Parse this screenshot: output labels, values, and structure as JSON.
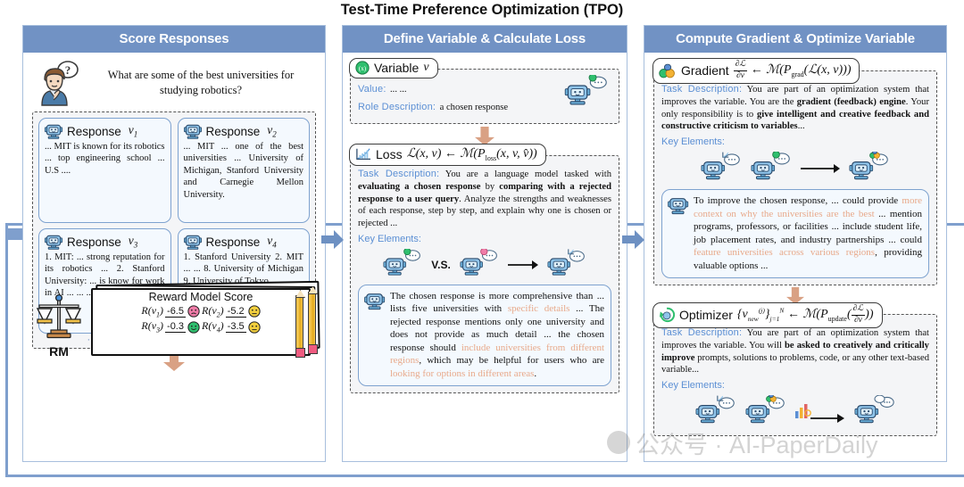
{
  "title": "Test-Time Preference Optimization (TPO)",
  "panels": {
    "score": {
      "header": "Score Responses",
      "query": "What are some of the best universities for studying robotics?",
      "query_icon": "person-question-icon",
      "responses": [
        {
          "label": "Response",
          "var": "v",
          "sub": "1",
          "text": "... MIT is known for its robotics ... top engineering school ... U.S ...."
        },
        {
          "label": "Response",
          "var": "v",
          "sub": "2",
          "text": "... MIT ... one of the best universities ... University of Michigan, Stanford University and Carnegie Mellon University."
        },
        {
          "label": "Response",
          "var": "v",
          "sub": "3",
          "text": "1. MIT: ... strong reputation for its robotics ... 2. Stanford University: ... is know for work in AI ... ... ... 5. CMU: ... oldest ..."
        },
        {
          "label": "Response",
          "var": "v",
          "sub": "4",
          "text": "1. Stanford University 2. MIT ... ... 8. University of Michigan 9. University of Tokyo"
        }
      ],
      "dots": [
        "· · ·",
        "· · ·",
        "· · ·",
        "· · ·"
      ],
      "rm": {
        "icon": "balance-scale-icon",
        "label": "RM",
        "card_title": "Reward Model Score",
        "scores": [
          {
            "key": "R",
            "var": "v",
            "sub": "1",
            "value": "-6.5",
            "face": "sad",
            "face_color": "#f07ca8"
          },
          {
            "key": "R",
            "var": "v",
            "sub": "2",
            "value": "-5.2",
            "face": "neutral",
            "face_color": "#f2cf3e"
          },
          {
            "key": "R",
            "var": "v",
            "sub": "3",
            "value": "-0.3",
            "face": "happy",
            "face_color": "#2fbf6e"
          },
          {
            "key": "R",
            "var": "v",
            "sub": "4",
            "value": "-3.5",
            "face": "neutral",
            "face_color": "#f2cf3e"
          }
        ]
      }
    },
    "define": {
      "header": "Define Variable & Calculate Loss",
      "variable": {
        "chip_icon": "variable-green-icon",
        "chip_label": "Variable",
        "chip_var": "v",
        "value_label": "Value:",
        "value_text": "... ...",
        "role_label": "Role Description:",
        "role_text": "a chosen response",
        "robot_icon": "robot-chat-icon"
      },
      "loss": {
        "chip_icon": "loss-chart-icon",
        "chip_label": "Loss",
        "chip_formula": "L(x, v) ← M(P_loss(x, v, v̂))",
        "task_label": "Task Description:",
        "task_text_1": "You are a language model tasked with ",
        "task_bold_1": "evaluating a chosen response",
        "task_text_2": " by ",
        "task_bold_2": "comparing with a rejected response to a user query",
        "task_text_3": ". Analyze the strengths and weaknesses of each response, step by step, and explain why one is chosen or rejected ...",
        "key_elements_label": "Key Elements:",
        "vs_label": "V.S.",
        "robots": [
          "robot-chosen-icon",
          "robot-rejected-icon",
          "robot-loss-icon"
        ],
        "output_icon": "robot-icon",
        "output_parts": [
          {
            "t": "The chosen response is more comprehensive than ... lists five universities with ",
            "hl": false
          },
          {
            "t": "specific details",
            "hl": true
          },
          {
            "t": " ... The rejected response mentions only one university and does not provide as much detail ... the chosen response should ",
            "hl": false
          },
          {
            "t": "include universities from different regions",
            "hl": true
          },
          {
            "t": ", which may be helpful for users who are ",
            "hl": false
          },
          {
            "t": "looking for options in different areas",
            "hl": true
          },
          {
            "t": ".",
            "hl": false
          }
        ]
      }
    },
    "gradient": {
      "header": "Compute Gradient & Optimize Variable",
      "grad": {
        "chip_icon": "gradient-icon",
        "chip_label": "Gradient",
        "chip_formula": "∂L/∂v ← M(P_grad(L(x, v)))",
        "task_label": "Task Description:",
        "task_text_1": "You are part of an optimization system that improves the variable. You are the ",
        "task_bold_1": "gradient (feedback) engine",
        "task_text_2": ". Your only responsibility is to ",
        "task_bold_2": "give intelligent and creative feedback and constructive criticism to variables",
        "task_text_3": "...",
        "key_elements_label": "Key Elements:",
        "robots": [
          "robot-loss-icon",
          "robot-chosen-icon",
          "robot-gradient-icon"
        ],
        "output_icon": "robot-icon",
        "output_parts": [
          {
            "t": "To improve the chosen response, ... could provide ",
            "hl": false
          },
          {
            "t": "more context on why the universities are the best",
            "hl": true
          },
          {
            "t": " ... mention programs, professors, or facilities ... include student life, job placement rates, and industry partnerships ... could ",
            "hl": false
          },
          {
            "t": "feature universities across various regions",
            "hl": true
          },
          {
            "t": ", providing valuable options ...",
            "hl": false
          }
        ]
      },
      "optimizer": {
        "chip_icon": "optimizer-icon",
        "chip_label": "Optimizer",
        "chip_formula": "{v_new^(j)}_{j=1}^{N} ← M(P_update(∂L/∂v))",
        "task_label": "Task Description:",
        "task_text_1": "You are part of an optimization system that improves the variable. You will ",
        "task_bold_1": "be asked to creatively and critically improve",
        "task_text_2": " prompts, solutions to problems, code, or any other text-based variable...",
        "key_elements_label": "Key Elements:",
        "robots": [
          "robot-loss-icon",
          "robot-gradient-icon",
          "robot-new-icon"
        ]
      }
    }
  },
  "watermark": "公众号 · AI-PaperDaily",
  "colors": {
    "header_blue": "#7192c4",
    "panel_border": "#a8bfdd",
    "card_blue": "#7ea2cf",
    "card_fill": "#f4f9fe",
    "dashed_fill": "#f4f5f7",
    "label_blue": "#5b8fd4",
    "highlight": "#e8a98a",
    "arrow_tan": "#d9a184",
    "loop_blue": "#7f9fcd"
  }
}
